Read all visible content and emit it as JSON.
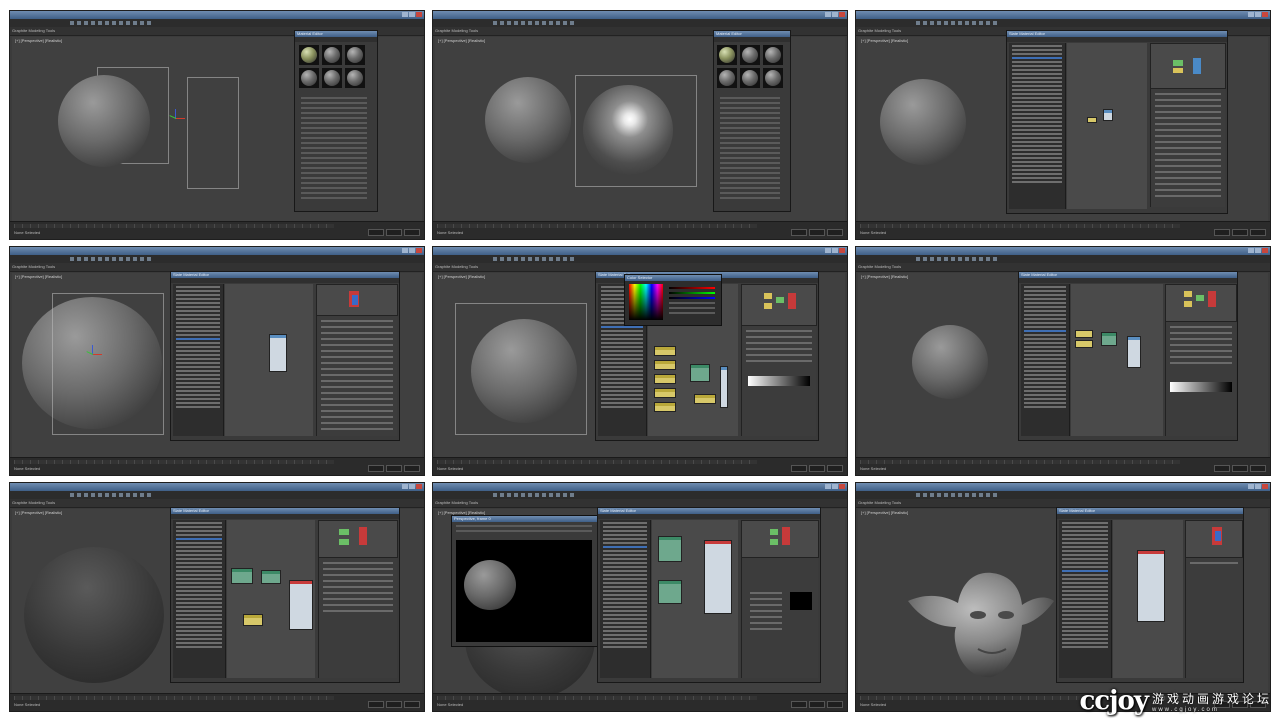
{
  "frame_labels": {
    "ribbon": "Graphite Modeling Tools",
    "viewport": "[+] [Perspective] [Realistic]",
    "status": "None Selected",
    "material_editor": "Material Editor",
    "slate_editor": "Slate Material Editor",
    "color_selector": "Color Selector",
    "render_window": "Perspective, frame 0"
  },
  "watermark": {
    "logo": "ccjoy",
    "chinese": "游戏动画游戏论坛",
    "url": "www.cgjoy.com"
  },
  "icons": [
    "minimize-icon",
    "maximize-icon",
    "close-icon",
    "transform-gizmo-icon"
  ]
}
